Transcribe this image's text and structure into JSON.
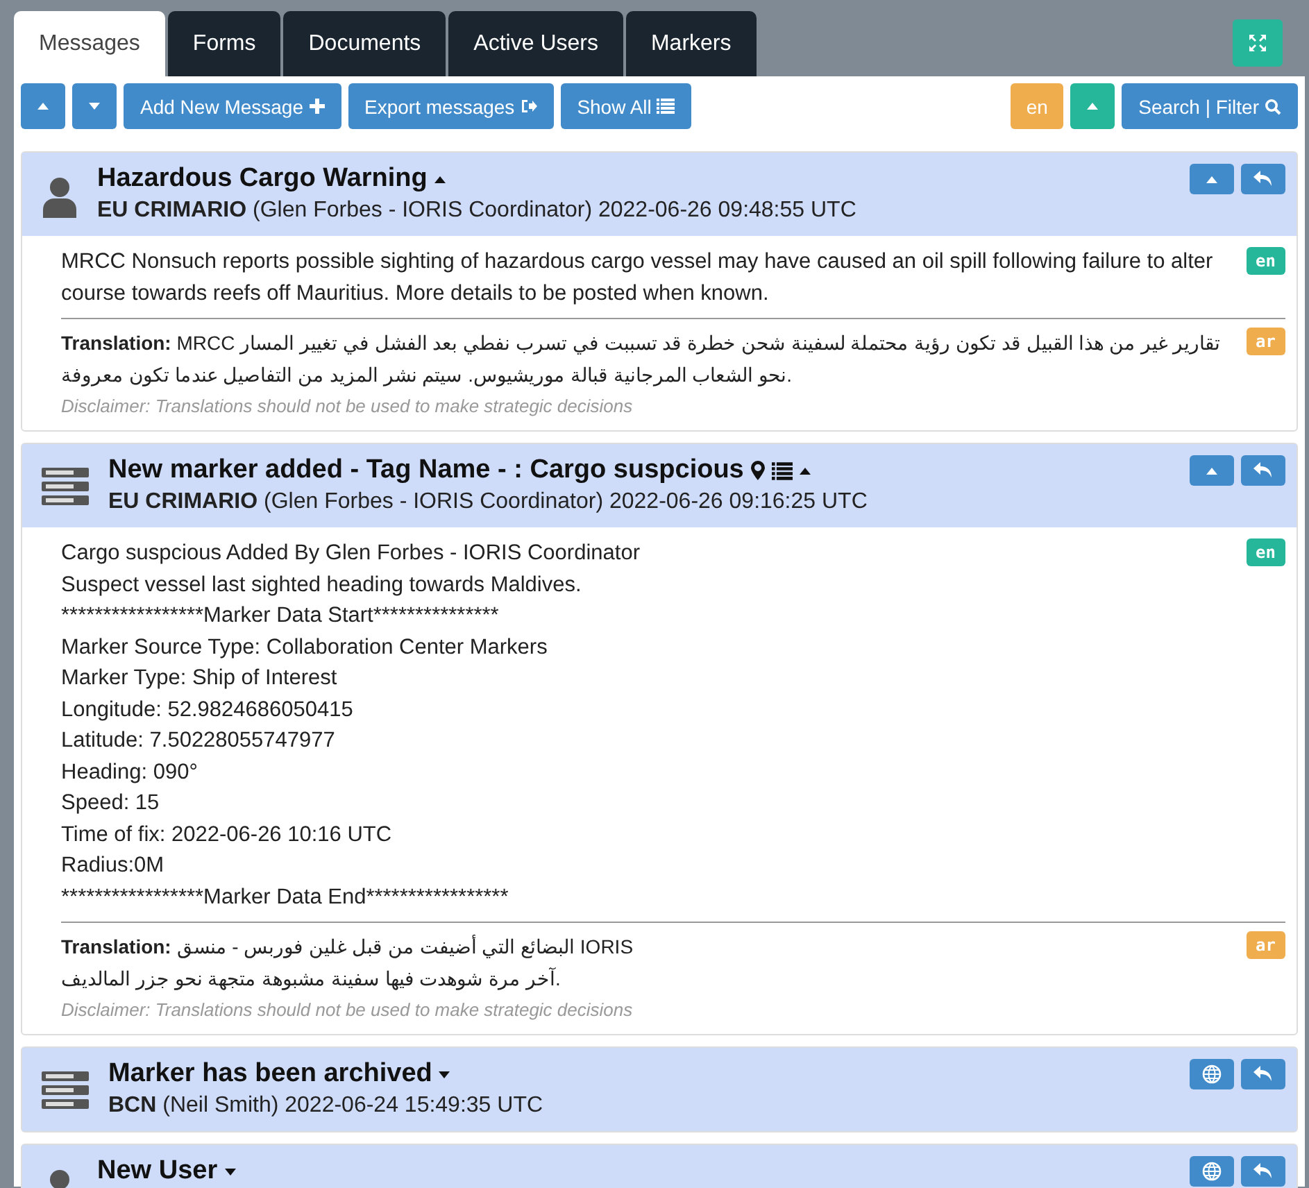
{
  "tabs": [
    {
      "label": "Messages",
      "selected": true
    },
    {
      "label": "Forms",
      "selected": false
    },
    {
      "label": "Documents",
      "selected": false
    },
    {
      "label": "Active Users",
      "selected": false
    },
    {
      "label": "Markers",
      "selected": false
    }
  ],
  "toolbar": {
    "left": [
      {
        "kind": "up"
      },
      {
        "kind": "down"
      },
      {
        "kind": "add",
        "label": "Add New Message"
      },
      {
        "kind": "export",
        "label": "Export messages"
      },
      {
        "kind": "show-all",
        "label": "Show All"
      }
    ],
    "right": [
      {
        "kind": "lang",
        "label": "en"
      },
      {
        "kind": "up-green"
      },
      {
        "kind": "search",
        "label": "Search | Filter"
      }
    ]
  },
  "messages": [
    {
      "kind": "user",
      "title": "Hazardous Cargo Warning",
      "expanded": true,
      "sender": "EU CRIMARIO",
      "author": "(Glen Forbes - IORIS Coordinator) 2022-06-26 09:48:55 UTC",
      "lang": "en",
      "body": [
        "MRCC Nonsuch reports possible sighting of hazardous cargo vessel may have caused an oil spill following failure to alter course towards reefs off Mauritius. More details to be posted when known."
      ],
      "translation": {
        "lang": "ar",
        "lines": [
          "**Translation:** MRCC تقارير غير من هذا القبيل قد تكون رؤية محتملة لسفينة شحن خطرة قد تسببت في تسرب نفطي بعد الفشل في تغيير المسار نحو الشعاب المرجانية قبالة موريشيوس. سيتم نشر المزيد من التفاصيل عندما تكون معروفة."
        ],
        "disclaimer": "Disclaimer: Translations should not be used to make strategic decisions"
      }
    },
    {
      "kind": "marker-added",
      "title": "New marker added - Tag Name - : Cargo suspcious",
      "expanded": true,
      "sender": "EU CRIMARIO",
      "author": "(Glen Forbes - IORIS Coordinator) 2022-06-26 09:16:25 UTC",
      "lang": "en",
      "body": [
        "Cargo suspcious Added By Glen Forbes - IORIS Coordinator",
        "Suspect vessel last sighted heading towards Maldives.",
        "*****************Marker Data Start***************",
        "Marker Source Type: Collaboration Center Markers",
        "Marker Type: Ship of Interest",
        "Longitude: 52.9824686050415",
        "Latitude: 7.50228055747977",
        "Heading: 090°",
        "Speed: 15",
        "Time of fix: 2022-06-26 10:16 UTC",
        "Radius:0M",
        "*****************Marker Data End*****************"
      ],
      "translation": {
        "lang": "ar",
        "lines": [
          "**Translation:** البضائع التي أضيفت من قبل غلين فوربس - منسق IORIS",
          "آخر مرة شوهدت فيها سفينة مشبوهة متجهة نحو جزر المالديف."
        ],
        "disclaimer": "Disclaimer: Translations should not be used to make strategic decisions"
      }
    },
    {
      "kind": "marker",
      "title": "Marker has been archived",
      "expanded": false,
      "sender": "BCN",
      "author": "(Neil Smith) 2022-06-24 15:49:35 UTC"
    },
    {
      "kind": "user",
      "title": "New User",
      "expanded": false
    }
  ]
}
